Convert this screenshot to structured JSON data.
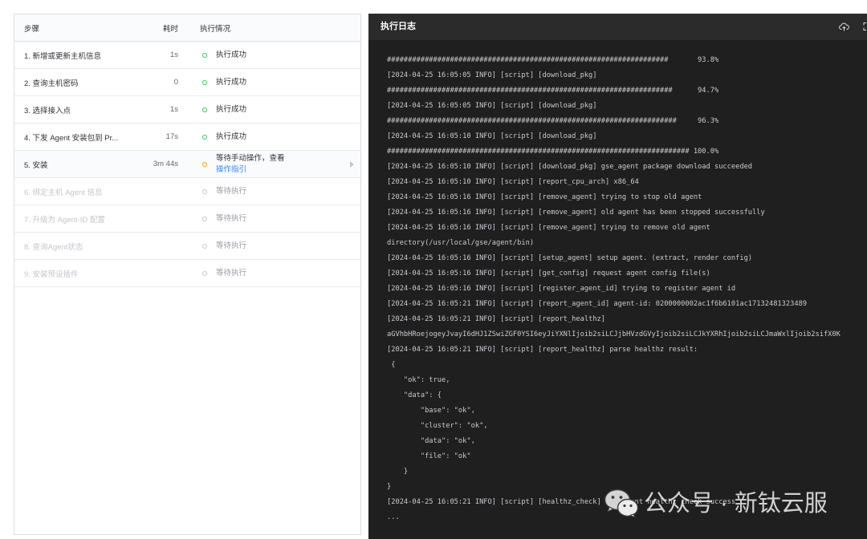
{
  "steps_table": {
    "headers": {
      "step": "步骤",
      "duration": "耗时",
      "status": "执行情况"
    },
    "rows": [
      {
        "step": "1. 新增或更新主机信息",
        "duration": "1s",
        "status": "执行成功",
        "status_icon": "circle-icon",
        "status_color": "#2dcb56"
      },
      {
        "step": "2. 查询主机密码",
        "duration": "0",
        "status": "执行成功",
        "status_icon": "circle-icon",
        "status_color": "#2dcb56"
      },
      {
        "step": "3. 选择接入点",
        "duration": "1s",
        "status": "执行成功",
        "status_icon": "circle-icon",
        "status_color": "#2dcb56"
      },
      {
        "step": "4. 下发 Agent 安装包到 Pr...",
        "duration": "17s",
        "status": "执行成功",
        "status_icon": "circle-icon",
        "status_color": "#2dcb56"
      },
      {
        "step": "5. 安装",
        "duration": "3m 44s",
        "status": "等待手动操作，查看",
        "status_link": "操作指引",
        "status_icon": "circle-icon",
        "status_color": "#ff9c01",
        "row_icon": "caret-right-icon"
      },
      {
        "step": "6. 绑定主机 Agent 信息",
        "status": "等待执行",
        "status_icon": "circle-icon",
        "status_color": "#c4c6cc"
      },
      {
        "step": "7. 升级为 Agent-ID 配置",
        "status": "等待执行",
        "status_icon": "circle-icon",
        "status_color": "#c4c6cc"
      },
      {
        "step": "8. 查询Agent状态",
        "status": "等待执行",
        "status_icon": "circle-icon",
        "status_color": "#c4c6cc"
      },
      {
        "step": "9. 安装预设插件",
        "status": "等待执行",
        "status_icon": "circle-icon",
        "status_color": "#c4c6cc"
      }
    ]
  },
  "log_panel": {
    "title": "执行日志",
    "header_icons": [
      "upload-cloud-icon",
      "fullscreen-icon"
    ],
    "lines": [
      "###################################################################       93.8%",
      "[2024-04-25 16:05:05 INFO] [script] [download_pkg]",
      "####################################################################      94.7%",
      "[2024-04-25 16:05:05 INFO] [script] [download_pkg]",
      "#####################################################################     96.3%",
      "[2024-04-25 16:05:10 INFO] [script] [download_pkg]",
      "######################################################################## 100.0%",
      "[2024-04-25 16:05:10 INFO] [script] [download_pkg] gse_agent package download succeeded",
      "[2024-04-25 16:05:10 INFO] [script] [report_cpu_arch] x86_64",
      "[2024-04-25 16:05:16 INFO] [script] [remove_agent] trying to stop old agent",
      "[2024-04-25 16:05:16 INFO] [script] [remove_agent] old agent has been stopped successfully",
      "[2024-04-25 16:05:16 INFO] [script] [remove_agent] trying to remove old agent",
      "directory(/usr/local/gse/agent/bin)",
      "[2024-04-25 16:05:16 INFO] [script] [setup_agent] setup agent. (extract, render config)",
      "[2024-04-25 16:05:16 INFO] [script] [get_config] request agent config file(s)",
      "[2024-04-25 16:05:16 INFO] [script] [register_agent_id] trying to register agent id",
      "[2024-04-25 16:05:21 INFO] [script] [report_agent_id] agent-id: 0200000002ac1f6b6101ac17132481323489",
      "[2024-04-25 16:05:21 INFO] [script] [report_healthz]",
      "aGVhbHRoejogeyJvayI6dHJ1ZSwiZGF0YSI6eyJiYXNlIjoib2siLCJjbHVzdGVyIjoib2siLCJkYXRhIjoib2siLCJmaWxlIjoib2sifX0K",
      "[2024-04-25 16:05:21 INFO] [script] [report_healthz] parse healthz result:",
      " {",
      "    \"ok\": true,",
      "    \"data\": {",
      "        \"base\": \"ok\",",
      "        \"cluster\": \"ok\",",
      "        \"data\": \"ok\",",
      "        \"file\": \"ok\"",
      "    }",
      "}",
      "[2024-04-25 16:05:21 INFO] [script] [healthz_check] gse agent healthz check success",
      "..."
    ]
  },
  "watermark": {
    "icon": "wechat-icon",
    "text": "公众号 · 新钛云服"
  },
  "colors": {
    "success": "#2dcb56",
    "waiting": "#ff9c01",
    "pending": "#c4c6cc",
    "link": "#3a84ff",
    "log_background": "#1f1f1f",
    "log_header_background": "#2b2b2b",
    "log_text": "#c9cbd1"
  }
}
